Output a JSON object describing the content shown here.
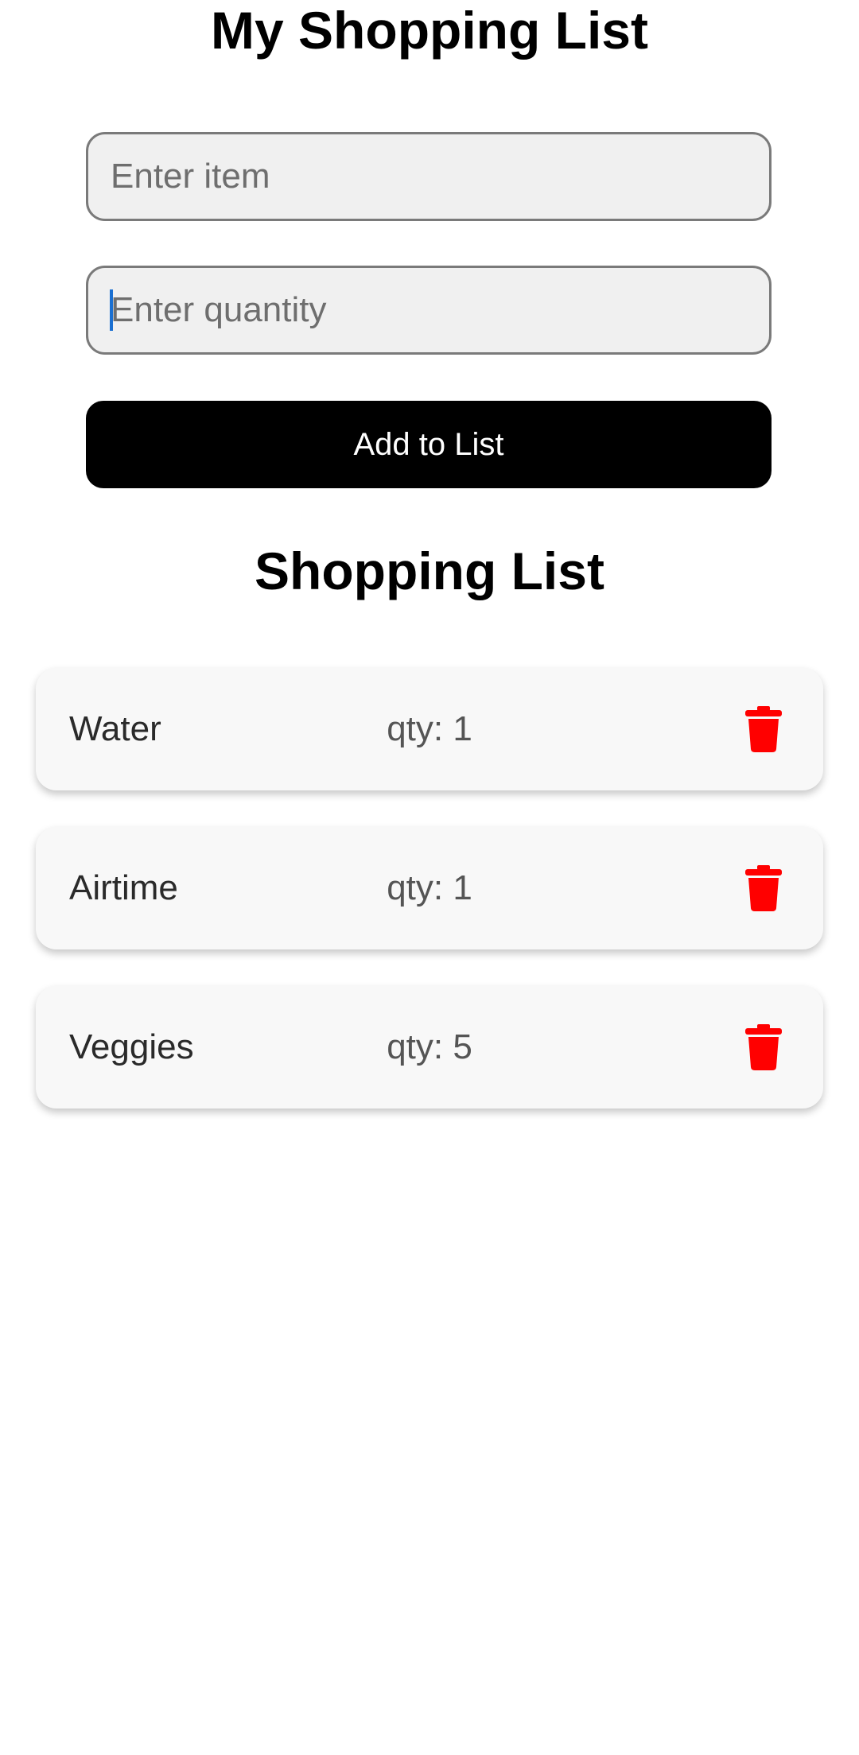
{
  "header": {
    "title": "My Shopping List"
  },
  "form": {
    "item_placeholder": "Enter item",
    "item_value": "",
    "quantity_placeholder": "Enter quantity",
    "quantity_value": "",
    "add_button_label": "Add to List"
  },
  "list": {
    "title": "Shopping List",
    "items": [
      {
        "name": "Water",
        "qty_text": "qty: 1",
        "delete_icon": "trash-icon"
      },
      {
        "name": "Airtime",
        "qty_text": "qty: 1",
        "delete_icon": "trash-icon"
      },
      {
        "name": "Veggies",
        "qty_text": "qty: 5",
        "delete_icon": "trash-icon"
      }
    ]
  },
  "colors": {
    "primary_button": "#000000",
    "delete_icon": "#ff0000",
    "input_background": "#f0f0f0",
    "card_background": "#f8f8f8"
  }
}
